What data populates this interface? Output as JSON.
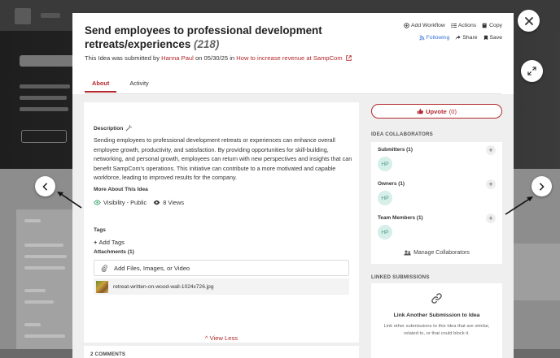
{
  "idea": {
    "title": "Send employees to professional development retreats/experiences",
    "count": "(218)",
    "submitted_prefix": "This Idea was submitted by",
    "submitter": "Hanna Paul",
    "on_text": "on",
    "date": "05/30/25",
    "in_text": "in",
    "challenge": "How to increase revenue at SampCom"
  },
  "actions": {
    "add_workflow": "Add Workflow",
    "actions": "Actions",
    "copy": "Copy",
    "following": "Following",
    "share": "Share",
    "save": "Save"
  },
  "tabs": [
    {
      "label": "About"
    },
    {
      "label": "Activity"
    }
  ],
  "description": {
    "label": "Description",
    "text": "Sending employees to professional development retreats or experiences can enhance overall employee growth, productivity, and satisfaction. By providing opportunities for skill-building, networking, and personal growth, employees can return with new perspectives and insights that can benefit SampCom's operations. This initiative can contribute to a more motivated and capable workforce, leading to improved results for the company."
  },
  "more_about": {
    "label": "More About This Idea",
    "visibility": "Visibility - Public",
    "views": "8 Views"
  },
  "tags": {
    "label": "Tags",
    "add": "Add Tags"
  },
  "attachments": {
    "label": "Attachments (1)",
    "add": "Add Files, Images, or Video",
    "file": "retreat-written-on-wood-wall-1024x726.jpg"
  },
  "view_less": "View Less",
  "comments_label": "2 COMMENTS",
  "upvote": {
    "label": "Upvote",
    "count": "(0)"
  },
  "collaborators": {
    "heading": "IDEA COLLABORATORS",
    "submitters": {
      "label": "Submitters (1)",
      "initials": "HP"
    },
    "owners": {
      "label": "Owners (1)",
      "initials": "HP"
    },
    "team": {
      "label": "Team Members (1)",
      "initials": "HP"
    },
    "manage": "Manage Collaborators"
  },
  "linked": {
    "heading": "LINKED SUBMISSIONS",
    "title": "Link Another Submission to Idea",
    "desc": "Link other submissions to this Idea that are similar, related to, or that could block it."
  },
  "colors": {
    "accent": "#b3282d",
    "link_blue": "#3a6fd8",
    "avatar_bg": "#d6efe9",
    "avatar_text": "#4a9a86"
  }
}
